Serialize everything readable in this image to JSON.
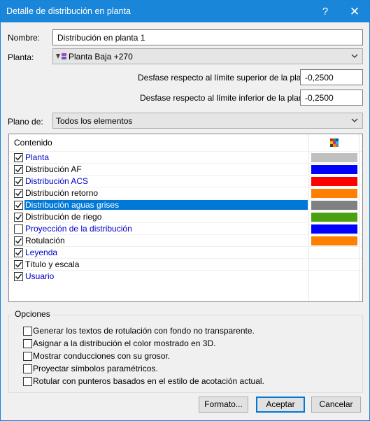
{
  "window": {
    "title": "Detalle de distribución en planta",
    "help": "?",
    "close": "✕"
  },
  "nombre": {
    "label": "Nombre:",
    "value": "Distribución en planta 1"
  },
  "planta": {
    "label": "Planta:",
    "value": "Planta Baja +270"
  },
  "desfase_sup": {
    "label": "Desfase respecto al límite superior de la planta:",
    "value": "-0,2500"
  },
  "desfase_inf": {
    "label": "Desfase respecto al límite inferior de la planta:",
    "value": "-0,2500"
  },
  "plano": {
    "label": "Plano de:",
    "value": "Todos los elementos"
  },
  "list": {
    "header": "Contenido",
    "rows": [
      {
        "label": "Planta",
        "checked": true,
        "link": true,
        "color": "#c0c0c0"
      },
      {
        "label": "Distribución AF",
        "checked": true,
        "link": false,
        "color": "#0000ff"
      },
      {
        "label": "Distribución ACS",
        "checked": true,
        "link": true,
        "color": "#ff0000"
      },
      {
        "label": "Distribución retorno",
        "checked": true,
        "link": false,
        "color": "#ff8000"
      },
      {
        "label": "Distribución aguas grises",
        "checked": true,
        "link": false,
        "color": "#808080",
        "selected": true
      },
      {
        "label": "Distribución de riego",
        "checked": true,
        "link": false,
        "color": "#4aa010"
      },
      {
        "label": "Proyección de la distribución",
        "checked": false,
        "link": true,
        "color": "#0000ff"
      },
      {
        "label": "Rotulación",
        "checked": true,
        "link": false,
        "color": "#ff8000"
      },
      {
        "label": "Leyenda",
        "checked": true,
        "link": true,
        "color": ""
      },
      {
        "label": "Título y escala",
        "checked": true,
        "link": false,
        "color": ""
      },
      {
        "label": "Usuario",
        "checked": true,
        "link": true,
        "color": ""
      }
    ]
  },
  "opciones": {
    "title": "Opciones",
    "items": [
      "Generar los textos de rotulación con fondo no transparente.",
      "Asignar a la distribución el color mostrado en 3D.",
      "Mostrar conducciones con su grosor.",
      "Proyectar símbolos paramétricos.",
      "Rotular con punteros basados en el estilo de acotación actual."
    ]
  },
  "buttons": {
    "formato": "Formato...",
    "aceptar": "Aceptar",
    "cancelar": "Cancelar"
  }
}
